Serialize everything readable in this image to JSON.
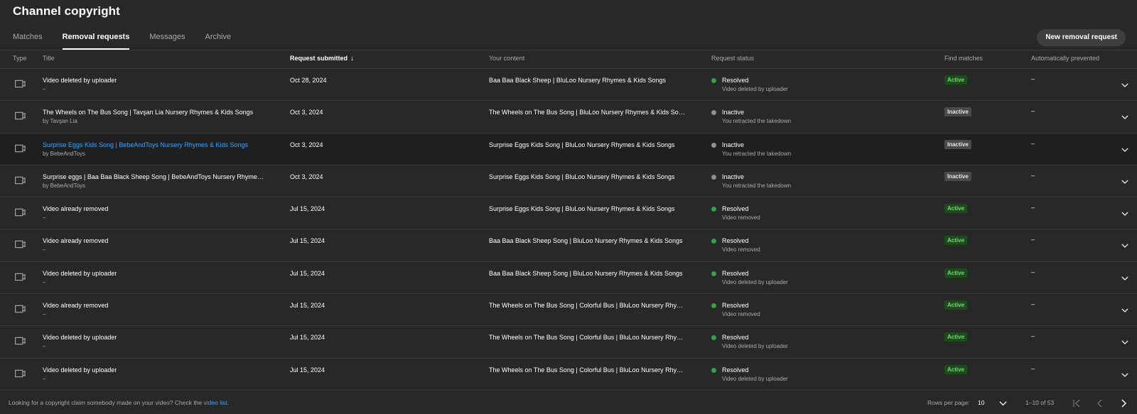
{
  "page": {
    "title": "Channel copyright"
  },
  "tabs": [
    {
      "label": "Matches",
      "active": false
    },
    {
      "label": "Removal requests",
      "active": true
    },
    {
      "label": "Messages",
      "active": false
    },
    {
      "label": "Archive",
      "active": false
    }
  ],
  "actions": {
    "new_removal_label": "New removal request"
  },
  "table": {
    "columns": {
      "type": "Type",
      "title": "Title",
      "request_submitted": "Request submitted",
      "your_content": "Your content",
      "request_status": "Request status",
      "find_matches": "Find matches",
      "automatically_prevented": "Automatically prevented"
    },
    "sort_icon": "arrow-down-icon",
    "rows": [
      {
        "type_icon": "video-icon",
        "title": "Video deleted by uploader",
        "title_link": false,
        "subtitle": "–",
        "date": "Oct 28, 2024",
        "content": "Baa Baa Black Sheep | BluLoo Nursery Rhymes & Kids Songs",
        "content_link": false,
        "status": "Resolved",
        "status_color": "#2ba640",
        "status_detail": "Video deleted by uploader",
        "find_matches": "Active",
        "prevented": "–"
      },
      {
        "type_icon": "video-icon",
        "title": "The Wheels on The Bus Song | Tavşan Lia Nursery Rhymes & Kids Songs",
        "title_link": false,
        "subtitle": "by Tavşan Lia",
        "date": "Oct 3, 2024",
        "content": "The Wheels on The Bus Song | BluLoo Nursery Rhymes & Kids Songs",
        "content_link": false,
        "status": "Inactive",
        "status_color": "#909090",
        "status_detail": "You retracted the takedown",
        "find_matches": "Inactive",
        "prevented": "–"
      },
      {
        "type_icon": "video-icon",
        "title": "Surprise Eggs Kids Song | BebeAndToys Nursery Rhymes & Kids Songs",
        "title_link": true,
        "subtitle": "by BebeAndToys",
        "date": "Oct 3, 2024",
        "content": "Surprise Eggs Kids Song | BluLoo Nursery Rhymes & Kids Songs",
        "content_link": true,
        "status": "Inactive",
        "status_color": "#909090",
        "status_detail": "You retracted the takedown",
        "find_matches": "Inactive",
        "prevented": "–"
      },
      {
        "type_icon": "video-icon",
        "title": "Surprise eggs | Baa Baa Black Sheep Song | BebeAndToys Nursery Rhymes &...",
        "title_link": false,
        "subtitle": "by BebeAndToys",
        "date": "Oct 3, 2024",
        "content": "Surprise Eggs Kids Song | BluLoo Nursery Rhymes & Kids Songs",
        "content_link": false,
        "status": "Inactive",
        "status_color": "#909090",
        "status_detail": "You retracted the takedown",
        "find_matches": "Inactive",
        "prevented": "–"
      },
      {
        "type_icon": "video-icon",
        "title": "Video already removed",
        "title_link": false,
        "subtitle": "–",
        "date": "Jul 15, 2024",
        "content": "Surprise Eggs Kids Song | BluLoo Nursery Rhymes & Kids Songs",
        "content_link": false,
        "status": "Resolved",
        "status_color": "#2ba640",
        "status_detail": "Video removed",
        "find_matches": "Active",
        "prevented": "–"
      },
      {
        "type_icon": "video-icon",
        "title": "Video already removed",
        "title_link": false,
        "subtitle": "–",
        "date": "Jul 15, 2024",
        "content": "Baa Baa Black Sheep Song | BluLoo Nursery Rhymes & Kids Songs",
        "content_link": false,
        "status": "Resolved",
        "status_color": "#2ba640",
        "status_detail": "Video removed",
        "find_matches": "Active",
        "prevented": "–"
      },
      {
        "type_icon": "video-icon",
        "title": "Video deleted by uploader",
        "title_link": false,
        "subtitle": "–",
        "date": "Jul 15, 2024",
        "content": "Baa Baa Black Sheep Song | BluLoo Nursery Rhymes & Kids Songs",
        "content_link": false,
        "status": "Resolved",
        "status_color": "#2ba640",
        "status_detail": "Video deleted by uploader",
        "find_matches": "Active",
        "prevented": "–"
      },
      {
        "type_icon": "video-icon",
        "title": "Video already removed",
        "title_link": false,
        "subtitle": "–",
        "date": "Jul 15, 2024",
        "content": "The Wheels on The Bus Song | Colorful Bus | BluLoo Nursery Rhyme...",
        "content_link": false,
        "status": "Resolved",
        "status_color": "#2ba640",
        "status_detail": "Video removed",
        "find_matches": "Active",
        "prevented": "–"
      },
      {
        "type_icon": "video-icon",
        "title": "Video deleted by uploader",
        "title_link": false,
        "subtitle": "–",
        "date": "Jul 15, 2024",
        "content": "The Wheels on The Bus Song | Colorful Bus | BluLoo Nursery Rhyme...",
        "content_link": false,
        "status": "Resolved",
        "status_color": "#2ba640",
        "status_detail": "Video deleted by uploader",
        "find_matches": "Active",
        "prevented": "–"
      },
      {
        "type_icon": "video-icon",
        "title": "Video deleted by uploader",
        "title_link": false,
        "subtitle": "–",
        "date": "Jul 15, 2024",
        "content": "The Wheels on The Bus Song | Colorful Bus | BluLoo Nursery Rhyme...",
        "content_link": false,
        "status": "Resolved",
        "status_color": "#2ba640",
        "status_detail": "Video deleted by uploader",
        "find_matches": "Active",
        "prevented": "–"
      }
    ],
    "expand_icon": "chevron-down-icon"
  },
  "footer": {
    "note_prefix": "Looking for a copyright claim somebody made on your video? Check the ",
    "note_link": "video list",
    "note_suffix": ".",
    "rows_per_page_label": "Rows per page:",
    "rows_per_page_value": "10",
    "range": "1–10 of 53",
    "pagination_icons": [
      "first-page-icon",
      "previous-page-icon",
      "next-page-icon"
    ]
  },
  "colors": {
    "background": "#282828",
    "link": "#3ea6ff",
    "resolved": "#2ba640",
    "inactive": "#909090"
  }
}
